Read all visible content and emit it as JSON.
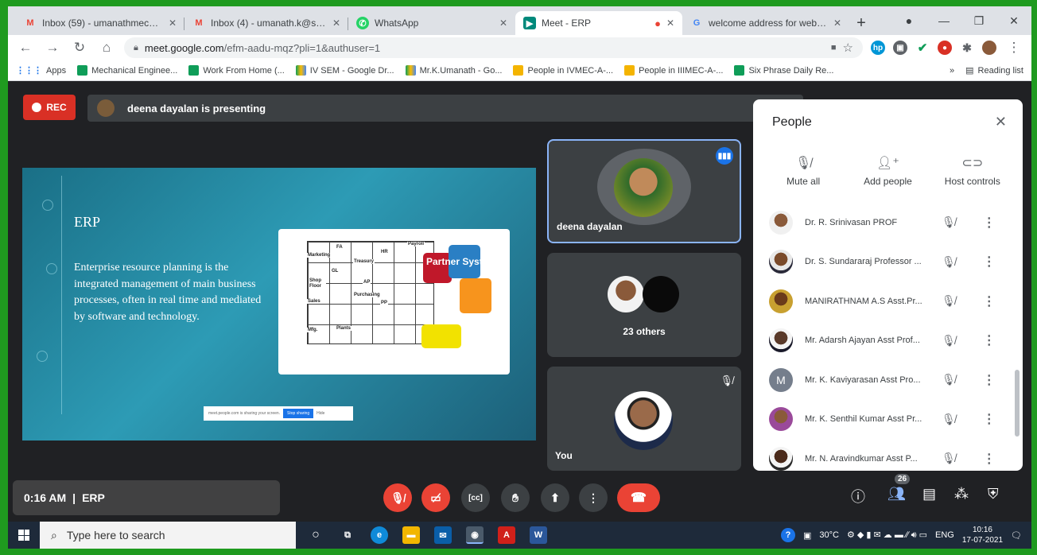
{
  "tabs": [
    {
      "label": "Inbox (59) - umanathmech@",
      "icon": "gmail-icon",
      "active": false
    },
    {
      "label": "Inbox (4) - umanath.k@skct.e",
      "icon": "gmail-icon",
      "active": false
    },
    {
      "label": "WhatsApp",
      "icon": "whatsapp-icon",
      "active": false
    },
    {
      "label": "Meet - ERP",
      "icon": "meet-icon",
      "active": true
    },
    {
      "label": "welcome address for webinar",
      "icon": "google-icon",
      "active": false
    }
  ],
  "address": {
    "host": "meet.google.com",
    "path": "/efm-aadu-mqz?pli=1&authuser=1"
  },
  "bookmarks": [
    {
      "label": "Apps",
      "color": "#1a73e8"
    },
    {
      "label": "Mechanical Enginee...",
      "color": "#0f9d58"
    },
    {
      "label": "Work From Home (...",
      "color": "#0f9d58"
    },
    {
      "label": "IV SEM - Google Dr...",
      "color": "#fbbc04"
    },
    {
      "label": "Mr.K.Umanath - Go...",
      "color": "#fbbc04"
    },
    {
      "label": "People in IVMEC-A-...",
      "color": "#f4b400"
    },
    {
      "label": "People in IIIMEC-A-...",
      "color": "#f4b400"
    },
    {
      "label": "Six Phrase Daily Re...",
      "color": "#0f9d58"
    }
  ],
  "reading_list": "Reading list",
  "meet": {
    "rec_label": "REC",
    "presenting_text": "deena dayalan is presenting",
    "slide": {
      "title": "ERP",
      "body": "Enterprise resource planning is the integrated management of main business processes, often in real time and mediated by software and technology.",
      "partner_text": "Partner Systems",
      "puzzle_labels": [
        "FA",
        "HR",
        "Payroll",
        "Marketing",
        "Treasury",
        "GL",
        "Shop Floor",
        "Sales",
        "Purchasing",
        "PP",
        "AP",
        "Mfg.",
        "Plants"
      ],
      "share_text": "meet.people.com is sharing your screen.",
      "stop_label": "Stop sharing",
      "hide_label": "Hide"
    },
    "tiles": [
      {
        "name": "deena dayalan"
      },
      {
        "name": "23 others"
      },
      {
        "name": "You"
      }
    ]
  },
  "people": {
    "title": "People",
    "actions": [
      {
        "label": "Mute all",
        "icon": "mic-off-icon"
      },
      {
        "label": "Add people",
        "icon": "add-person-icon"
      },
      {
        "label": "Host controls",
        "icon": "toggle-icon"
      }
    ],
    "list": [
      {
        "name": "Dr. R. Srinivasan PROF",
        "initial": ""
      },
      {
        "name": "Dr. S. Sundararaj Professor ...",
        "initial": ""
      },
      {
        "name": "MANIRATHNAM A.S Asst.Pr...",
        "initial": ""
      },
      {
        "name": "Mr. Adarsh Ajayan Asst Prof...",
        "initial": ""
      },
      {
        "name": "Mr. K. Kaviyarasan Asst Pro...",
        "initial": "M"
      },
      {
        "name": "Mr. K. Senthil Kumar Asst Pr...",
        "initial": ""
      },
      {
        "name": "Mr. N. Aravindkumar Asst P...",
        "initial": ""
      }
    ]
  },
  "controls": {
    "time": "0:16 AM",
    "separator": "|",
    "meeting_name": "ERP",
    "participants_count": "26"
  },
  "taskbar": {
    "search_placeholder": "Type here to search",
    "temperature": "30°C",
    "language": "ENG",
    "time": "10:16",
    "date": "17-07-2021"
  }
}
